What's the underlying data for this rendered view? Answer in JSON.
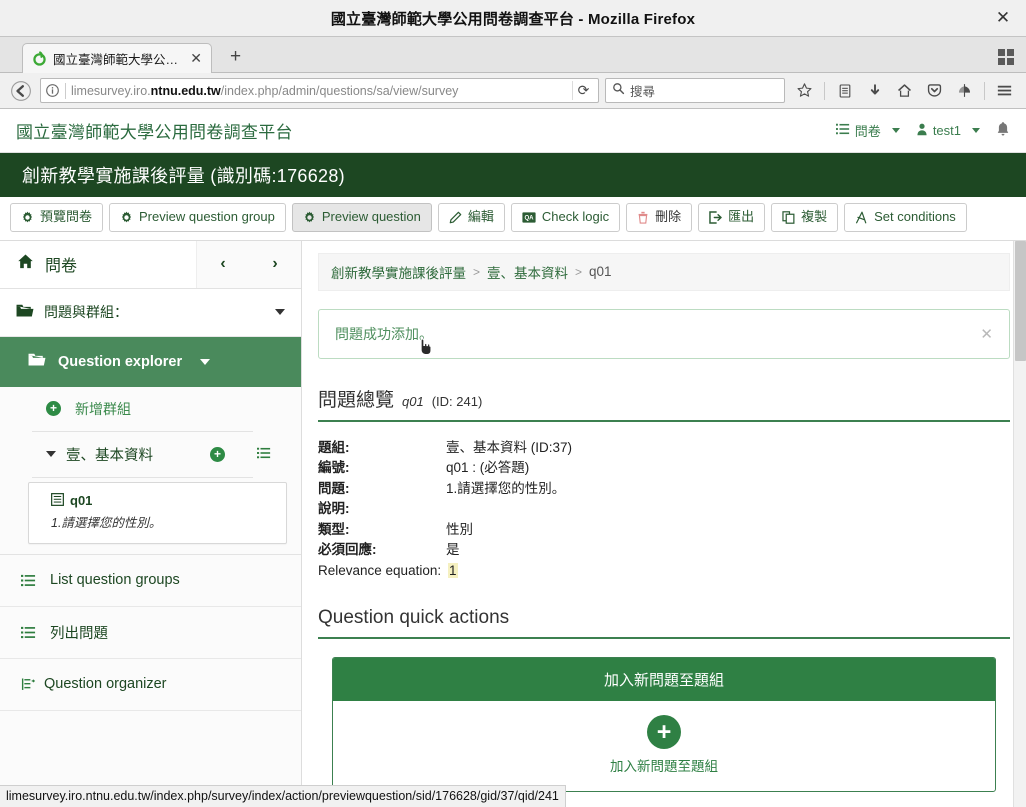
{
  "browser": {
    "window_title": "國立臺灣師範大學公用問卷調查平台 - Mozilla Firefox",
    "close_label": "✕",
    "tab": {
      "title": "國立臺灣師範大學公…",
      "close_label": "✕",
      "newtab_label": "+",
      "favicon_name": "limesurvey-favicon"
    },
    "nav": {
      "back_label": "←",
      "info_label": "ⓘ",
      "url_prefix": "limesurvey.iro.",
      "url_domain": "ntnu.edu.tw",
      "url_path": "/index.php/admin/questions/sa/view/survey",
      "reload_label": "⟳",
      "search_placeholder": "搜尋"
    },
    "toolbar_icons": [
      "bookmark-star-icon",
      "reading-list-icon",
      "downloads-icon",
      "home-icon",
      "pocket-icon",
      "sync-icon",
      "hamburger-menu-icon"
    ]
  },
  "app": {
    "brand": "國立臺灣師範大學公用問卷調查平台",
    "topnav": {
      "surveys_label": "問卷",
      "user_label": "test1",
      "bell_name": "notification-bell-icon"
    },
    "survey_title": "創新教學實施課後評量 (識別碼:176628)"
  },
  "toolbar": {
    "buttons": [
      {
        "label": "預覽問卷",
        "icon": "gear-icon",
        "active": false,
        "style": "normal"
      },
      {
        "label": "Preview question group",
        "icon": "gear-icon",
        "active": false,
        "style": "normal"
      },
      {
        "label": "Preview question",
        "icon": "gear-icon",
        "active": true,
        "style": "normal"
      },
      {
        "label": "編輯",
        "icon": "pencil-icon",
        "active": false,
        "style": "normal"
      },
      {
        "label": "Check logic",
        "icon": "logic-icon",
        "active": false,
        "style": "normal"
      },
      {
        "label": "刪除",
        "icon": "trash-icon",
        "active": false,
        "style": "danger"
      },
      {
        "label": "匯出",
        "icon": "export-icon",
        "active": false,
        "style": "normal"
      },
      {
        "label": "複製",
        "icon": "copy-icon",
        "active": false,
        "style": "normal"
      },
      {
        "label": "Set conditions",
        "icon": "conditions-icon",
        "active": false,
        "style": "normal"
      }
    ]
  },
  "sidebar": {
    "home_label": "問卷",
    "prev_label": "‹",
    "next_label": "›",
    "questions_groups_label": "問題與群組：",
    "explorer_label": "Question explorer",
    "add_group_label": "新增群組",
    "group": {
      "name": "壹、基本資料",
      "add_icon_label": "+",
      "list_icon_name": "list-icon"
    },
    "question": {
      "code": "q01",
      "text": "1.請選擇您的性別。"
    },
    "links": [
      {
        "label": "List question groups",
        "icon": "list-icon"
      },
      {
        "label": "列出問題",
        "icon": "list-icon"
      },
      {
        "label": "Question organizer",
        "icon": "organizer-icon"
      }
    ]
  },
  "main": {
    "breadcrumb": {
      "survey": "創新教學實施課後評量",
      "group": "壹、基本資料",
      "question": "q01",
      "separator": ">"
    },
    "alert": {
      "message": "問題成功添加。",
      "close_label": "✕"
    },
    "overview": {
      "heading": "問題總覽",
      "code": "q01",
      "id_text": "(ID: 241)",
      "rows": [
        {
          "key": "題組:",
          "value": "壹、基本資料 (ID:37)",
          "bold_key": true
        },
        {
          "key": "編號:",
          "value": "q01 : (必答題)",
          "bold_key": true
        },
        {
          "key": "問題:",
          "value": "1.請選擇您的性別。",
          "bold_key": true
        },
        {
          "key": "說明:",
          "value": "",
          "bold_key": true
        },
        {
          "key": "類型:",
          "value": "性別",
          "bold_key": true
        },
        {
          "key": "必須回應:",
          "value": "是",
          "bold_key": true
        },
        {
          "key": "Relevance equation:",
          "value": "1",
          "bold_key": false,
          "highlight": true
        }
      ]
    },
    "quick_actions": {
      "heading": "Question quick actions",
      "panel_title": "加入新問題至題組",
      "plus_label": "+",
      "panel_link": "加入新問題至題組"
    }
  },
  "statusbar": {
    "url": "limesurvey.iro.ntnu.edu.tw/index.php/survey/index/action/previewquestion/sid/176628/gid/37/qid/241"
  },
  "colors": {
    "brand_green": "#2b6b3f",
    "header_dark_green": "#1d4722",
    "explorer_green": "#4a8a5c",
    "panel_green": "#2f8044",
    "highlight_yellow": "#f5f0c0"
  }
}
